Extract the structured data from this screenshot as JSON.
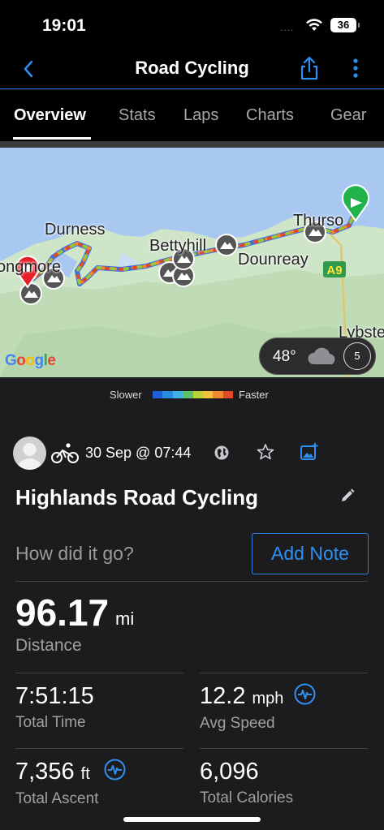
{
  "status_bar": {
    "time": "19:01",
    "signal": "....",
    "battery": "36"
  },
  "nav": {
    "title": "Road Cycling",
    "back_icon": "chevron-left-icon",
    "share_icon": "share-icon",
    "more_icon": "more-vertical-icon"
  },
  "tabs": [
    {
      "label": "Overview",
      "active": true
    },
    {
      "label": "Stats",
      "active": false
    },
    {
      "label": "Laps",
      "active": false
    },
    {
      "label": "Charts",
      "active": false
    },
    {
      "label": "Gear",
      "active": false
    }
  ],
  "map": {
    "places": [
      "Durness",
      "Bettyhill",
      "Dounreay",
      "Thurso",
      "Lybster",
      "ongmore"
    ],
    "road_label": "A9",
    "attribution": "Google",
    "weather": {
      "temperature": "48°",
      "condition_icon": "cloud-icon",
      "wind_speed": "5"
    }
  },
  "legend": {
    "slower_label": "Slower",
    "faster_label": "Faster",
    "colors": [
      "#1f5fd8",
      "#2a8be0",
      "#3fb3e8",
      "#5ac06a",
      "#b8d23c",
      "#f0c43a",
      "#f08a2c",
      "#e04a2a"
    ]
  },
  "activity": {
    "date": "30 Sep @ 07:44",
    "type_icon": "bike-icon",
    "name": "Highlands Road Cycling",
    "note_prompt": "How did it go?",
    "add_note_label": "Add Note"
  },
  "stats": {
    "distance": {
      "value": "96.17",
      "unit": "mi",
      "label": "Distance"
    },
    "total_time": {
      "value": "7:51:15",
      "label": "Total Time"
    },
    "avg_speed": {
      "value": "12.2",
      "unit": "mph",
      "label": "Avg Speed"
    },
    "total_ascent": {
      "value": "7,356",
      "unit": "ft",
      "label": "Total Ascent"
    },
    "total_calories": {
      "value": "6,096",
      "label": "Total Calories"
    }
  }
}
